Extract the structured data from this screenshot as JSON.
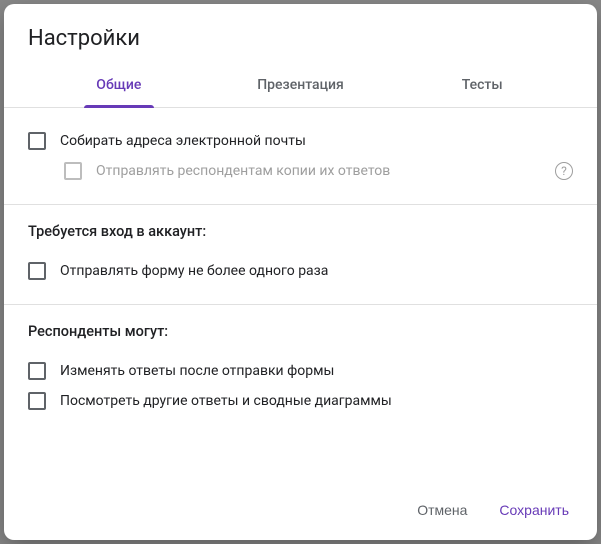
{
  "dialog_title": "Настройки",
  "tabs": {
    "general": "Общие",
    "presentation": "Презентация",
    "quizzes": "Тесты"
  },
  "section1": {
    "collect_emails": "Собирать адреса электронной почты",
    "send_copies": "Отправлять респондентам копии их ответов",
    "help": "?"
  },
  "section2": {
    "title": "Требуется вход в аккаунт:",
    "limit_once": "Отправлять форму не более одного раза"
  },
  "section3": {
    "title": "Респонденты могут:",
    "edit_after": "Изменять ответы после отправки формы",
    "see_summary": "Посмотреть другие ответы и сводные диаграммы"
  },
  "footer": {
    "cancel": "Отмена",
    "save": "Сохранить"
  }
}
